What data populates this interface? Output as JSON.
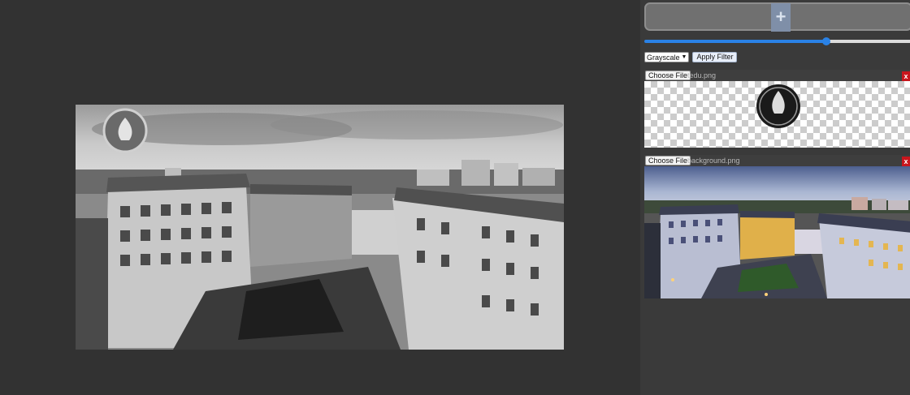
{
  "panel": {
    "add_label": "+",
    "opacity": 0.68,
    "filter": {
      "selected": "Grayscale",
      "apply_label": "Apply Filter"
    },
    "layers": [
      {
        "choose_label": "Choose File",
        "file_name": "tedu.png",
        "remove_label": "x"
      },
      {
        "choose_label": "Choose File",
        "file_name": "background.png",
        "remove_label": "x"
      }
    ]
  },
  "colors": {
    "accent": "#2a82e6",
    "remove": "#c8161d",
    "background": "#333333"
  },
  "icons": {
    "logo": "tedu-logo-icon"
  }
}
